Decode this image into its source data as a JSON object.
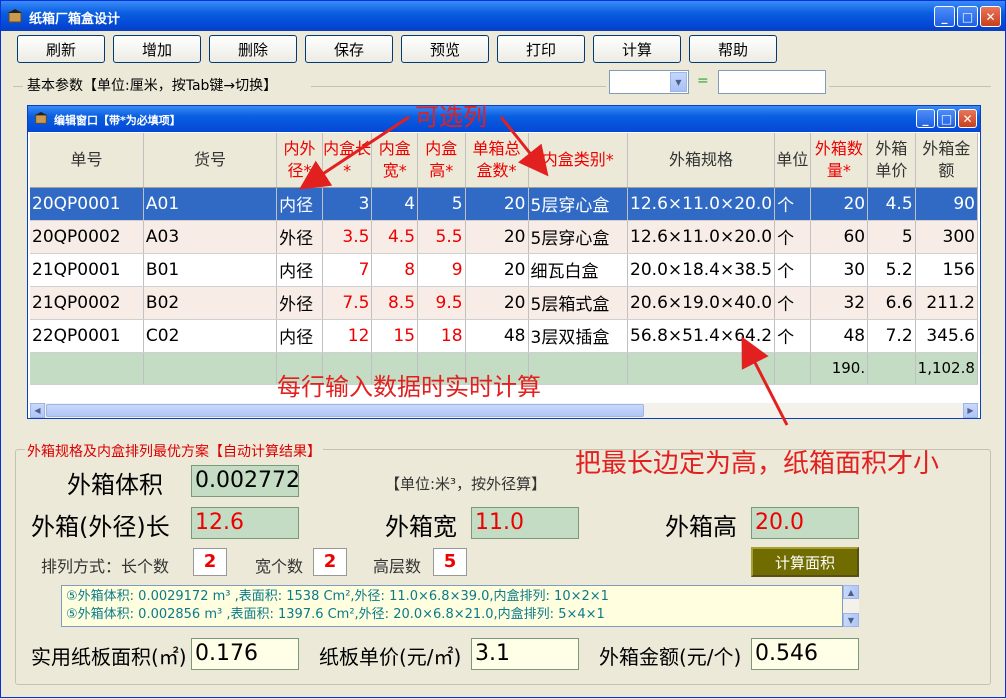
{
  "window": {
    "title": "纸箱厂箱盒设计"
  },
  "toolbar": [
    "刷新",
    "增加",
    "删除",
    "保存",
    "预览",
    "打印",
    "计算",
    "帮助"
  ],
  "basic_params": {
    "label": "基本参数【单位:厘米，按Tab键→切换】",
    "equals": "="
  },
  "edit_window": {
    "title": "编辑窗口【带*为必填项】"
  },
  "columns": [
    {
      "label": "单号",
      "required": false
    },
    {
      "label": "货号",
      "required": false
    },
    {
      "label": "内外径*",
      "required": true
    },
    {
      "label": "内盒长*",
      "required": true
    },
    {
      "label": "内盒宽*",
      "required": true
    },
    {
      "label": "内盒高*",
      "required": true
    },
    {
      "label": "单箱总盒数*",
      "required": true
    },
    {
      "label": "内盒类别*",
      "required": true
    },
    {
      "label": "外箱规格",
      "required": false
    },
    {
      "label": "单位",
      "required": false
    },
    {
      "label": "外箱数量*",
      "required": true
    },
    {
      "label": "外箱单价",
      "required": false
    },
    {
      "label": "外箱金额",
      "required": false
    }
  ],
  "rows": [
    [
      "20QP0001",
      "A01",
      "内径",
      "3",
      "4",
      "5",
      "20",
      "5层穿心盒",
      "12.6×11.0×20.0",
      "个",
      "20",
      "4.5",
      "90"
    ],
    [
      "20QP0002",
      "A03",
      "外径",
      "3.5",
      "4.5",
      "5.5",
      "20",
      "5层穿心盒",
      "12.6×11.0×20.0",
      "个",
      "60",
      "5",
      "300"
    ],
    [
      "21QP0001",
      "B01",
      "内径",
      "7",
      "8",
      "9",
      "20",
      "细瓦白盒",
      "20.0×18.4×38.5",
      "个",
      "30",
      "5.2",
      "156"
    ],
    [
      "21QP0002",
      "B02",
      "外径",
      "7.5",
      "8.5",
      "9.5",
      "20",
      "5层箱式盒",
      "20.6×19.0×40.0",
      "个",
      "32",
      "6.6",
      "211.2"
    ],
    [
      "22QP0001",
      "C02",
      "内径",
      "12",
      "15",
      "18",
      "48",
      "3层双插盒",
      "56.8×51.4×64.2",
      "个",
      "48",
      "7.2",
      "345.6"
    ]
  ],
  "totals": {
    "qty": "190.",
    "amount": "1,102.8"
  },
  "annotations": {
    "optional_columns": "可选列",
    "realtime": "每行输入数据时实时计算",
    "longest_height": "把最长边定为高，纸箱面积才小"
  },
  "result": {
    "group_label": "外箱规格及内盒排列最优方案【自动计算结果】",
    "volume_label": "外箱体积",
    "volume": "0.0027720",
    "unit_note": "【单位:米³，按外径算】",
    "length_label": "外箱(外径)长",
    "length": "12.6",
    "width_label": "外箱宽",
    "width": "11.0",
    "height_label": "外箱高",
    "height": "20.0",
    "arrange_label": "排列方式：长个数",
    "count_l": "2",
    "count_w_label": "宽个数",
    "count_w": "2",
    "count_h_label": "高层数",
    "count_h": "5",
    "calc_button": "计算面积",
    "memo": [
      "⑤外箱体积: 0.0029172 m³ ,表面积: 1538 Cm²,外径: 11.0×6.8×39.0,内盒排列: 10×2×1",
      "⑤外箱体积: 0.002856 m³ ,表面积: 1397.6 Cm²,外径: 20.0×6.8×21.0,内盒排列: 5×4×1"
    ],
    "area_label": "实用纸板面积(㎡)",
    "area": "0.176",
    "price_label": "纸板单价(元/㎡)",
    "price": "3.1",
    "amount_label": "外箱金额(元/个)",
    "amount": "0.546"
  },
  "colors": {
    "required": "#e00000",
    "selected_row": "#316ac5",
    "total_row": "#c4dcc4",
    "annotation": "#e32020"
  }
}
